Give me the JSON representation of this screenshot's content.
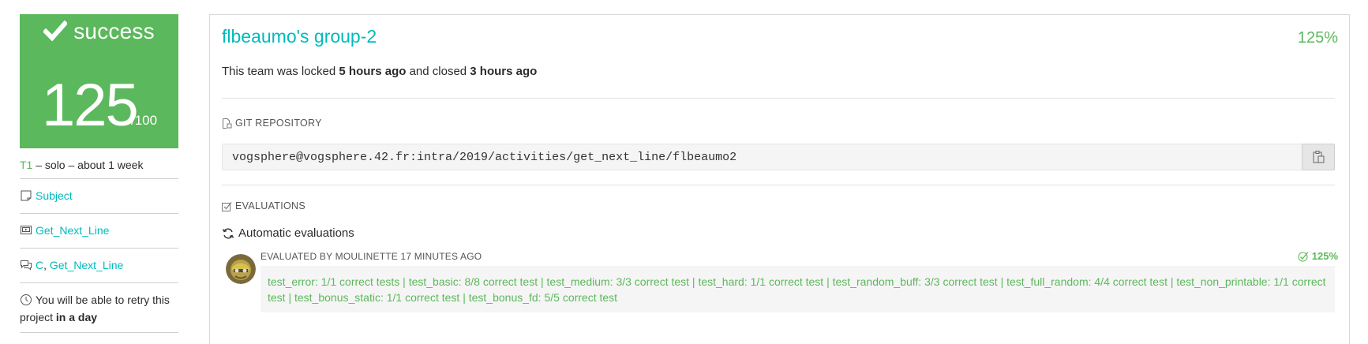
{
  "status": {
    "label": "success",
    "score": "125",
    "max": "/100",
    "color": "#5cb85c"
  },
  "project_meta": {
    "tier": "T1",
    "rest": " – solo – about 1 week"
  },
  "left_links": {
    "subject": "Subject",
    "project": "Get_Next_Line",
    "forum_lang": "C",
    "forum_sep": ", ",
    "forum_project": "Get_Next_Line"
  },
  "retry": {
    "prefix": "You will be able to retry this project ",
    "bold": "in a day"
  },
  "team": {
    "title": "flbeaumo's group-2",
    "percent": "125%",
    "lock_prefix": "This team was locked ",
    "locked_ago": "5 hours ago",
    "lock_mid": " and closed ",
    "closed_ago": "3 hours ago"
  },
  "repo": {
    "heading": "GIT REPOSITORY",
    "url": "vogsphere@vogsphere.42.fr:intra/2019/activities/get_next_line/flbeaumo2"
  },
  "evaluations": {
    "heading": "EVALUATIONS",
    "auto_label": "Automatic evaluations",
    "evaluated_by": "EVALUATED BY MOULINETTE 17 MINUTES AGO",
    "percent": "125%",
    "results": "test_error: 1/1 correct tests | test_basic: 8/8 correct test | test_medium: 3/3 correct test | test_hard: 1/1 correct test | test_random_buff: 3/3 correct test | test_full_random: 4/4 correct test | test_non_printable: 1/1 correct test | test_bonus_static: 1/1 correct test | test_bonus_fd: 5/5 correct test"
  },
  "icons": {
    "check": "check-icon",
    "subject": "document-icon",
    "project": "video-icon",
    "forum": "chat-icon",
    "clock": "clock-icon",
    "repo": "file-icon",
    "evaluations": "checkbox-icon",
    "refresh": "refresh-icon",
    "copy": "clipboard-icon"
  },
  "colors": {
    "accent": "#00babc",
    "success": "#5cb85c"
  }
}
